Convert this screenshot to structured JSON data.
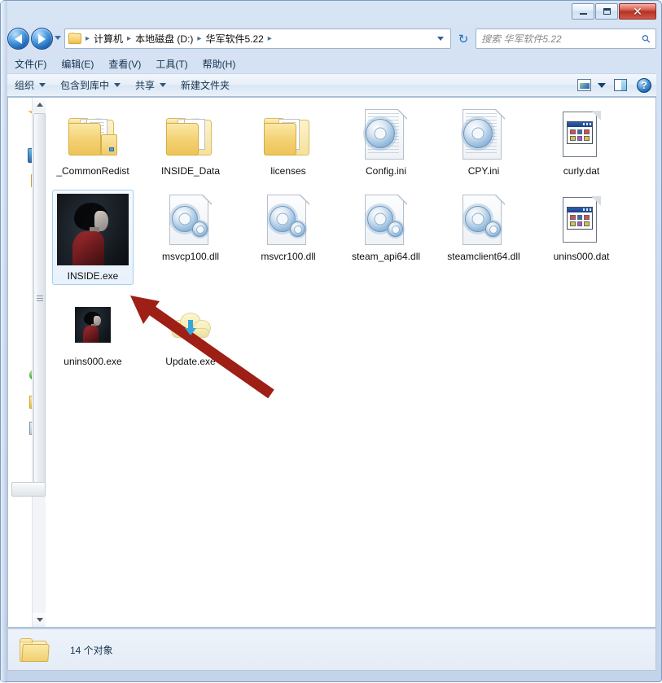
{
  "window": {
    "controls": {
      "minimize": "–",
      "maximize": "❑",
      "close": "✕"
    }
  },
  "addressbar": {
    "back_title": "后退",
    "forward_title": "前进",
    "recent_caret": "▼",
    "crumbs": [
      "计算机",
      "本地磁盘 (D:)",
      "华军软件5.22"
    ],
    "separator": "▸",
    "dropdown": "▼",
    "refresh": "↻"
  },
  "search": {
    "placeholder": "搜索 华军软件5.22",
    "icon": "⚲"
  },
  "menubar": {
    "items": [
      {
        "label": "文件(F)"
      },
      {
        "label": "编辑(E)"
      },
      {
        "label": "查看(V)"
      },
      {
        "label": "工具(T)"
      },
      {
        "label": "帮助(H)"
      }
    ]
  },
  "toolbar": {
    "items": [
      {
        "label": "组织",
        "caret": true
      },
      {
        "label": "包含到库中",
        "caret": true
      },
      {
        "label": "共享",
        "caret": true
      },
      {
        "label": "新建文件夹",
        "caret": false
      }
    ],
    "help_label": "?"
  },
  "navpane": {
    "icons": [
      {
        "name": "favorites-star-icon"
      },
      {
        "name": "desktop-icon"
      },
      {
        "name": "library-folder-icon"
      },
      {
        "name": "network-icon"
      },
      {
        "name": "folder-icon"
      },
      {
        "name": "computer-icon"
      }
    ]
  },
  "files": [
    {
      "name": "_CommonRedist",
      "icon": "folder-stack",
      "selected": false
    },
    {
      "name": "INSIDE_Data",
      "icon": "folder-stack",
      "selected": false
    },
    {
      "name": "licenses",
      "icon": "folder-stack",
      "selected": false
    },
    {
      "name": "Config.ini",
      "icon": "gear-document",
      "selected": false
    },
    {
      "name": "CPY.ini",
      "icon": "gear-document",
      "selected": false
    },
    {
      "name": "curly.dat",
      "icon": "dat-file",
      "selected": false
    },
    {
      "name": "INSIDE.exe",
      "icon": "inside-game",
      "selected": true
    },
    {
      "name": "msvcp100.dll",
      "icon": "gear-document",
      "selected": false
    },
    {
      "name": "msvcr100.dll",
      "icon": "gear-document",
      "selected": false
    },
    {
      "name": "steam_api64.dll",
      "icon": "gear-document",
      "selected": false
    },
    {
      "name": "steamclient64.dll",
      "icon": "gear-document",
      "selected": false
    },
    {
      "name": "unins000.dat",
      "icon": "dat-file",
      "selected": false
    },
    {
      "name": "unins000.exe",
      "icon": "inside-game-small",
      "selected": false
    },
    {
      "name": "Update.exe",
      "icon": "cloud-download",
      "selected": false
    }
  ],
  "statusbar": {
    "text": "14 个对象"
  },
  "annotation": {
    "arrow_color": "#9e1f16"
  }
}
